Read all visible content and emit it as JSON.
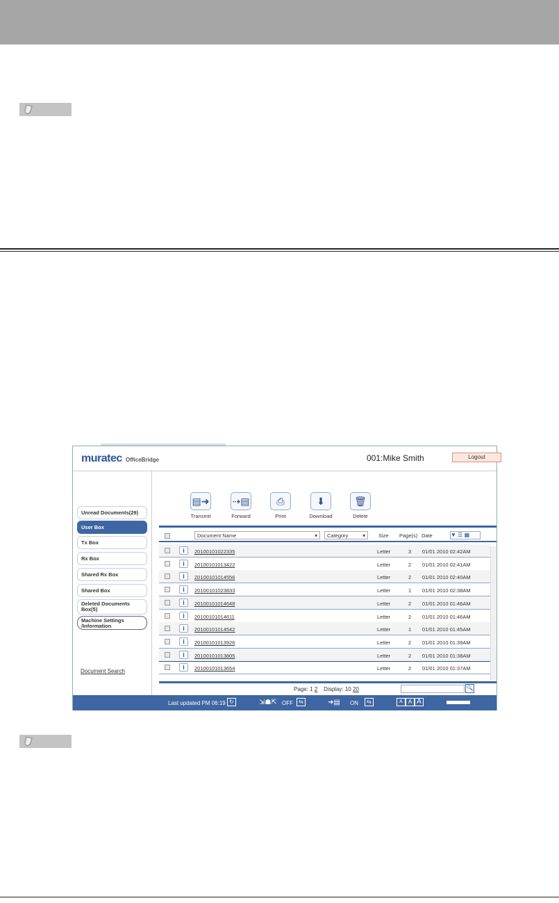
{
  "app": {
    "logo": "muratec",
    "product": "OfficeBridge",
    "user": "001:Mike Smith",
    "logout": "Logout",
    "sidebar": [
      "Unread Documents(29)",
      "User Box",
      "Tx Box",
      "Rx Box",
      "Shared Rx Box",
      "Shared Box",
      "Deleted Documents Box(5)",
      "Machine Settings /Information"
    ],
    "active_item": "User Box",
    "document_search": "Document Search",
    "toolbar": [
      {
        "label": "Transmit",
        "icon": "transmit-icon"
      },
      {
        "label": "Forward",
        "icon": "forward-icon"
      },
      {
        "label": "Print",
        "icon": "printer-icon"
      },
      {
        "label": "Download",
        "icon": "download-icon"
      },
      {
        "label": "Delete",
        "icon": "trash-icon"
      }
    ],
    "columns": {
      "name": "Document Name",
      "category": "Category",
      "size": "Size",
      "pages": "Page(s)",
      "date": "Date"
    },
    "rows": [
      {
        "name": "20100101022335",
        "size": "Letter",
        "pages": "3",
        "date": "01/01 2010 02:42AM"
      },
      {
        "name": "20100101013422",
        "size": "Letter",
        "pages": "2",
        "date": "01/01 2010 02:41AM"
      },
      {
        "name": "20100101014556",
        "size": "Letter",
        "pages": "2",
        "date": "01/01 2010 02:40AM"
      },
      {
        "name": "20100101023833",
        "size": "Letter",
        "pages": "1",
        "date": "01/01 2010 02:38AM"
      },
      {
        "name": "20100101014648",
        "size": "Letter",
        "pages": "2",
        "date": "01/01 2010 01:46AM"
      },
      {
        "name": "20100101014611",
        "size": "Letter",
        "pages": "2",
        "date": "01/01 2010 01:46AM"
      },
      {
        "name": "20100101014542",
        "size": "Letter",
        "pages": "1",
        "date": "01/01 2010 01:45AM"
      },
      {
        "name": "20100101013926",
        "size": "Letter",
        "pages": "2",
        "date": "01/01 2010 01:39AM"
      },
      {
        "name": "20100101013805",
        "size": "Letter",
        "pages": "2",
        "date": "01/01 2010 01:38AM"
      },
      {
        "name": "20100101013654",
        "size": "Letter",
        "pages": "2",
        "date": "01/01 2010 01:37AM"
      }
    ],
    "pagination": {
      "page_label": "Page:",
      "page_current": "1",
      "page_other": "2",
      "display_label": "Display:",
      "display_current": "10",
      "display_other": "20"
    },
    "footer": {
      "last_updated": "Last updated PM 06:19",
      "off": "OFF",
      "on": "ON",
      "font_sizes": [
        "A",
        "A",
        "A"
      ]
    },
    "colors": {
      "accent": "#3e66a3"
    }
  }
}
